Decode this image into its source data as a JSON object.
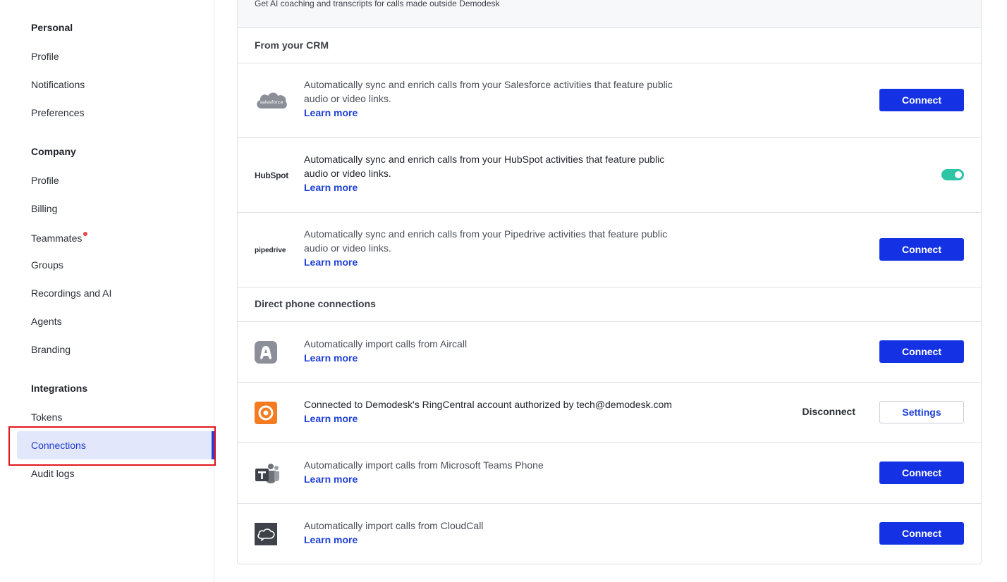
{
  "sidebar": {
    "personal": {
      "title": "Personal",
      "items": [
        "Profile",
        "Notifications",
        "Preferences"
      ]
    },
    "company": {
      "title": "Company",
      "items": [
        "Profile",
        "Billing",
        "Teammates",
        "Groups",
        "Recordings and AI",
        "Agents",
        "Branding"
      ]
    },
    "integrations": {
      "title": "Integrations",
      "items": [
        "Tokens",
        "Connections",
        "Audit logs"
      ],
      "active": "Connections"
    },
    "colors": {
      "active_bg": "#e3e7fb",
      "active_text": "#1f3bd0",
      "notification_dot": "#e5484d",
      "highlight_outline": "#e2161e"
    }
  },
  "main": {
    "banner_text": "Get AI coaching and transcripts for calls made outside Demodesk",
    "learn_more": "Learn more",
    "crm": {
      "title": "From your CRM",
      "rows": [
        {
          "logo": "salesforce-logo",
          "logo_text": "salesforce",
          "desc_line1": "Automatically sync and enrich calls from your Salesforce activities that feature public",
          "desc_line2": "audio or video links.",
          "action": "Connect"
        },
        {
          "logo": "hubspot-logo",
          "logo_text": "HubSpot",
          "desc_line1": "Automatically sync and enrich calls from your HubSpot activities that feature public",
          "desc_line2": "audio or video links.",
          "action": "toggle-on"
        },
        {
          "logo": "pipedrive-logo",
          "logo_text": "pipedrive",
          "desc_line1": "Automatically sync and enrich calls from your Pipedrive activities that feature public",
          "desc_line2": "audio or video links.",
          "action": "Connect"
        }
      ]
    },
    "phone": {
      "title": "Direct phone connections",
      "rows": [
        {
          "logo": "aircall-logo",
          "desc": "Automatically import calls from Aircall",
          "action": "Connect"
        },
        {
          "logo": "ringcentral-logo",
          "desc": "Connected to Demodesk's RingCentral account authorized by tech@demodesk.com",
          "disconnect": "Disconnect",
          "settings": "Settings"
        },
        {
          "logo": "microsoft-teams-logo",
          "desc": "Automatically import calls from Microsoft Teams Phone",
          "action": "Connect"
        },
        {
          "logo": "cloudcall-logo",
          "desc": "Automatically import calls from CloudCall",
          "action": "Connect"
        }
      ]
    },
    "colors": {
      "primary_button": "#1432e3",
      "link": "#1d3fd6",
      "toggle_on": "#2ec4a6",
      "ringcentral": "#f47b20"
    }
  }
}
